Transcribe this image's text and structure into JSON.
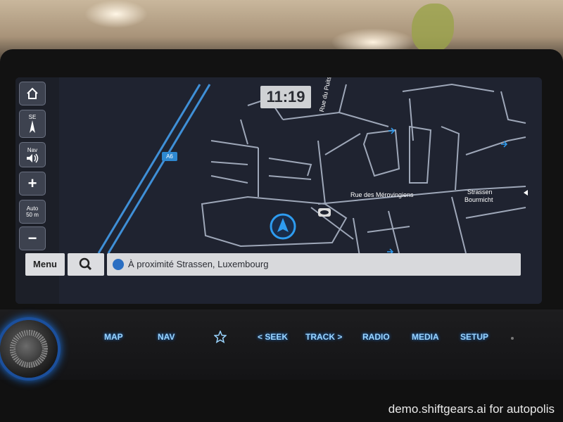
{
  "screen": {
    "clock": "11:19",
    "side_buttons": [
      {
        "name": "home",
        "icon": "home-icon"
      },
      {
        "name": "compass",
        "top_label": "SE",
        "icon": "compass-needle-icon"
      },
      {
        "name": "nav-volume",
        "top_label": "Nav",
        "icon": "speaker-icon"
      },
      {
        "name": "zoom-in",
        "label": "+"
      },
      {
        "name": "zoom-mode",
        "line1": "Auto",
        "line2": "50 m"
      },
      {
        "name": "zoom-out",
        "label": "−"
      }
    ],
    "bottom_bar": {
      "menu_label": "Menu",
      "search_icon": "search-icon",
      "location_text": "À proximité Strassen, Luxembourg"
    },
    "map_labels": {
      "street_1": "Rue du Puits R",
      "street_2": "Rue des Mérovingiens",
      "place_line1": "Strassen",
      "place_line2": "Bourmicht",
      "road_badge": "A6"
    },
    "colors": {
      "map_bg": "#1f2330",
      "road": "#9ea7b8",
      "highway": "#3f8fd6",
      "vehicle_marker": "#2e9cf0",
      "hw_button_glow": "#9ad4ff"
    }
  },
  "hardware_buttons": [
    {
      "name": "map",
      "label": "MAP"
    },
    {
      "name": "nav",
      "label": "NAV"
    },
    {
      "name": "favorite",
      "icon": "star-icon"
    },
    {
      "name": "seek",
      "label": "< SEEK"
    },
    {
      "name": "track",
      "label": "TRACK >"
    },
    {
      "name": "radio",
      "label": "RADIO"
    },
    {
      "name": "media",
      "label": "MEDIA"
    },
    {
      "name": "setup",
      "label": "SETUP"
    }
  ],
  "watermark": "demo.shiftgears.ai for autopolis"
}
